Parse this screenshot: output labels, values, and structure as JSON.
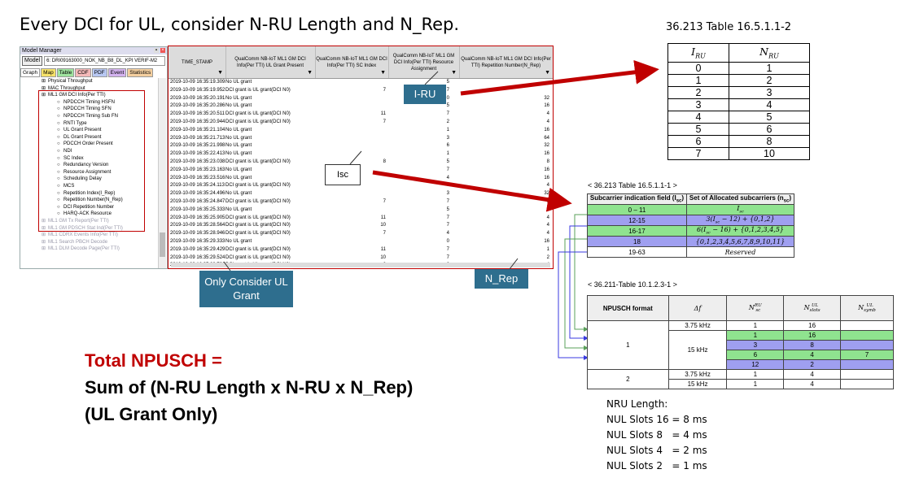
{
  "title": "Every DCI for UL, consider N-RU Length and N_Rep.",
  "model_manager": {
    "window_title": "Model Manager",
    "model_button": "Model",
    "model_path": "6: DRI09163000_NOK_NB_B8_DL_KPI VERIF-M2",
    "tabs": [
      "Graph",
      "Map",
      "Table",
      "CDF",
      "PDF",
      "Event",
      "Statistics"
    ],
    "tab_colors": [
      "#ffffff",
      "#f6e26a",
      "#9fe39f",
      "#f4b9b9",
      "#b7c7f2",
      "#d3b2ef",
      "#f4cf9f"
    ],
    "tree": [
      {
        "label": "Physical Throughput",
        "indent": 1,
        "icon": "folder",
        "gray": false
      },
      {
        "label": "MAC Throughput",
        "indent": 1,
        "icon": "folder",
        "gray": false
      },
      {
        "label": "ML1 GM DCI Info(Per TTI)",
        "indent": 1,
        "icon": "folder",
        "gray": false
      },
      {
        "label": "NPDCCH Timing HSFN",
        "indent": 2,
        "icon": "field",
        "gray": false
      },
      {
        "label": "NPDCCH Timing SFN",
        "indent": 2,
        "icon": "field",
        "gray": false
      },
      {
        "label": "NPDCCH Timing Sub FN",
        "indent": 2,
        "icon": "field",
        "gray": false
      },
      {
        "label": "RNTI Type",
        "indent": 2,
        "icon": "field",
        "gray": false
      },
      {
        "label": "UL Grant Present",
        "indent": 2,
        "icon": "field",
        "gray": false
      },
      {
        "label": "DL Grant Present",
        "indent": 2,
        "icon": "field",
        "gray": false
      },
      {
        "label": "PDCCH Order Present",
        "indent": 2,
        "icon": "field",
        "gray": false
      },
      {
        "label": "NDI",
        "indent": 2,
        "icon": "field",
        "gray": false
      },
      {
        "label": "SC Index",
        "indent": 2,
        "icon": "field",
        "gray": false
      },
      {
        "label": "Redundancy Version",
        "indent": 2,
        "icon": "field",
        "gray": false
      },
      {
        "label": "Resource Assignment",
        "indent": 2,
        "icon": "field",
        "gray": false
      },
      {
        "label": "Scheduling Delay",
        "indent": 2,
        "icon": "field",
        "gray": false
      },
      {
        "label": "MCS",
        "indent": 2,
        "icon": "field",
        "gray": false
      },
      {
        "label": "Repetition Index(I_Rep)",
        "indent": 2,
        "icon": "field",
        "gray": false
      },
      {
        "label": "Repetition Number(N_Rep)",
        "indent": 2,
        "icon": "field",
        "gray": false
      },
      {
        "label": "DCI Repetition Number",
        "indent": 2,
        "icon": "field",
        "gray": false
      },
      {
        "label": "HARQ-ACK Resource",
        "indent": 2,
        "icon": "field",
        "gray": false
      },
      {
        "label": "ML1 GM Tx Report(Per TTI)",
        "indent": 1,
        "icon": "folder",
        "gray": true
      },
      {
        "label": "ML1 GM PDSCH Stat Ind(Per TTI)",
        "indent": 1,
        "icon": "folder",
        "gray": true
      },
      {
        "label": "ML1 CDRX Events Info(Per TTI)",
        "indent": 1,
        "icon": "folder",
        "gray": true
      },
      {
        "label": "ML1 Search PBCH Decode",
        "indent": 1,
        "icon": "folder",
        "gray": true
      },
      {
        "label": "ML1 DLM Decode Page(Per TTI)",
        "indent": 1,
        "icon": "folder",
        "gray": true
      }
    ]
  },
  "grid": {
    "headers": [
      "TIME_STAMP",
      "QualComm NB-IoT ML1 GM DCI Info(Per TTI) UL Grant Present",
      "QualComm NB-IoT ML1 GM DCI Info(Per TTI) SC Index",
      "QualComm NB-IoT ML1 GM DCI Info(Per TTI) Resource Assignment",
      "QualComm NB-IoT ML1 GM DCI Info(Per TTI) Repetition Number(N_Rep)"
    ],
    "rows": [
      [
        "2019-10-09 16:35:19.309",
        "No UL grant",
        "",
        "5",
        ""
      ],
      [
        "2019-10-09 16:35:19.952",
        "DCI grant is UL grant(DCI N0)",
        "7",
        "7",
        ""
      ],
      [
        "2019-10-09 16:35:20.191",
        "No UL grant",
        "",
        "0",
        "32"
      ],
      [
        "2019-10-09 16:35:20.286",
        "No UL grant",
        "",
        "5",
        "16"
      ],
      [
        "2019-10-09 16:35:20.511",
        "DCI grant is UL grant(DCI N0)",
        "11",
        "7",
        "4"
      ],
      [
        "2019-10-09 16:35:20.944",
        "DCI grant is UL grant(DCI N0)",
        "7",
        "2",
        "4"
      ],
      [
        "2019-10-09 16:35:21.104",
        "No UL grant",
        "",
        "1",
        "16"
      ],
      [
        "2019-10-09 16:35:21.713",
        "No UL grant",
        "",
        "3",
        "64"
      ],
      [
        "2019-10-09 16:35:21.998",
        "No UL grant",
        "",
        "6",
        "32"
      ],
      [
        "2019-10-09 16:35:22.413",
        "No UL grant",
        "",
        "1",
        "16"
      ],
      [
        "2019-10-09 16:35:23.038",
        "DCI grant is UL grant(DCI N0)",
        "8",
        "5",
        "8"
      ],
      [
        "2019-10-09 16:35:23.163",
        "No UL grant",
        "",
        "7",
        "16"
      ],
      [
        "2019-10-09 16:35:23.516",
        "No UL grant",
        "",
        "4",
        "16"
      ],
      [
        "2019-10-09 16:35:24.113",
        "DCI grant is UL grant(DCI N0)",
        "",
        "7",
        "4"
      ],
      [
        "2019-10-09 16:35:24.496",
        "No UL grant",
        "",
        "3",
        "32"
      ],
      [
        "2019-10-09 16:35:24.847",
        "DCI grant is UL grant(DCI N0)",
        "7",
        "7",
        "1"
      ],
      [
        "2019-10-09 16:35:25.333",
        "No UL grant",
        "",
        "5",
        "4"
      ],
      [
        "2019-10-09 16:35:25.905",
        "DCI grant is UL grant(DCI N0)",
        "11",
        "7",
        "4"
      ],
      [
        "2019-10-09 16:35:28.564",
        "DCI grant is UL grant(DCI N0)",
        "10",
        "7",
        "4"
      ],
      [
        "2019-10-09 16:35:28.946",
        "DCI grant is UL grant(DCI N0)",
        "7",
        "4",
        "4"
      ],
      [
        "2019-10-09 16:35:29.333",
        "No UL grant",
        "",
        "0",
        "16"
      ],
      [
        "2019-10-09 16:35:29.429",
        "DCI grant is UL grant(DCI N0)",
        "11",
        "7",
        "1"
      ],
      [
        "2019-10-09 16:35:29.524",
        "DCI grant is UL grant(DCI N0)",
        "10",
        "7",
        "2"
      ],
      [
        "2019-10-09 16:35:29.736",
        "DCI grant is UL grant(DCI N0)",
        "6",
        "6",
        "4"
      ]
    ]
  },
  "callouts": {
    "iru": "I-RU",
    "isc": "Isc",
    "ul_grant": "Only Consider UL Grant",
    "nrep": "N_Rep"
  },
  "iru_table": {
    "caption": "36.213 Table 16.5.1.1-2",
    "col1": "I",
    "col1_sub": "RU",
    "col2": "N",
    "col2_sub": "RU",
    "rows": [
      [
        "0",
        "1"
      ],
      [
        "1",
        "2"
      ],
      [
        "2",
        "3"
      ],
      [
        "3",
        "4"
      ],
      [
        "4",
        "5"
      ],
      [
        "5",
        "6"
      ],
      [
        "6",
        "8"
      ],
      [
        "7",
        "10"
      ]
    ]
  },
  "sc_table": {
    "caption": "< 36.213 Table 16.5.1.1-1 >",
    "header1": "Subcarrier indication field (I",
    "header1_sub": "sc",
    "header2": "Set of Allocated subcarriers (n",
    "header2_sub": "sc",
    "rows": [
      {
        "field": "0 – 11",
        "set": "I",
        "set_sub": "sc",
        "color": "#8fe38f"
      },
      {
        "field": "12-15",
        "set": "3(I",
        "set_sub": "sc",
        "set_tail": " − 12) + {0,1,2}",
        "color": "#9f9ff0"
      },
      {
        "field": "16-17",
        "set": "6(I",
        "set_sub": "sc",
        "set_tail": " − 16) + {0,1,2,3,4,5}",
        "color": "#8fe38f"
      },
      {
        "field": "18",
        "set": "{0,1,2,3,4,5,6,7,8,9,10,11}",
        "set_sub": "",
        "color": "#9f9ff0"
      },
      {
        "field": "19-63",
        "set": "Reserved",
        "set_sub": "",
        "color": "#ffffff"
      }
    ]
  },
  "npusch_table": {
    "caption": "< 36.211-Table 10.1.2.3-1 >",
    "headers": [
      "NPUSCH format",
      "Δf",
      "N",
      "N",
      "N"
    ],
    "header_subs": [
      "",
      "",
      "sc",
      "slots",
      "symb"
    ],
    "header_sups": [
      "",
      "",
      "RU",
      "UL",
      "UL"
    ],
    "format1": "1",
    "format2": "2",
    "f1_rows": [
      {
        "df": "3.75 kHz",
        "nsc": "1",
        "nslots": "16",
        "color": "#ffffff"
      },
      {
        "df": "",
        "nsc": "1",
        "nslots": "16",
        "color": "#8fe38f"
      },
      {
        "df": "",
        "nsc": "3",
        "nslots": "8",
        "color": "#9f9ff0"
      },
      {
        "df": "",
        "nsc": "6",
        "nslots": "4",
        "color": "#8fe38f"
      },
      {
        "df": "",
        "nsc": "12",
        "nslots": "2",
        "color": "#9f9ff0"
      }
    ],
    "f1_df15": "15 kHz",
    "f1_nsymb": "7",
    "f2_rows": [
      {
        "df": "3.75 kHz",
        "nsc": "1",
        "nslots": "4"
      },
      {
        "df": "15 kHz",
        "nsc": "1",
        "nslots": "4"
      }
    ]
  },
  "total": {
    "line1": "Total NPUSCH =",
    "line2": "Sum of (N-RU Length x N-RU x N_Rep)",
    "line3": "(UL Grant Only)",
    "line1_color": "#c00000"
  },
  "nru": {
    "title": "NRU Length:",
    "lines": [
      "NUL Slots 16 = 8 ms",
      "NUL Slots 8   = 4 ms",
      "NUL Slots 4   = 2 ms",
      "NUL Slots 2   = 1 ms"
    ]
  },
  "colors": {
    "accent_red": "#c00000",
    "callout_blue": "#2e6e8e",
    "green": "#8fe38f",
    "purple": "#9f9ff0"
  }
}
